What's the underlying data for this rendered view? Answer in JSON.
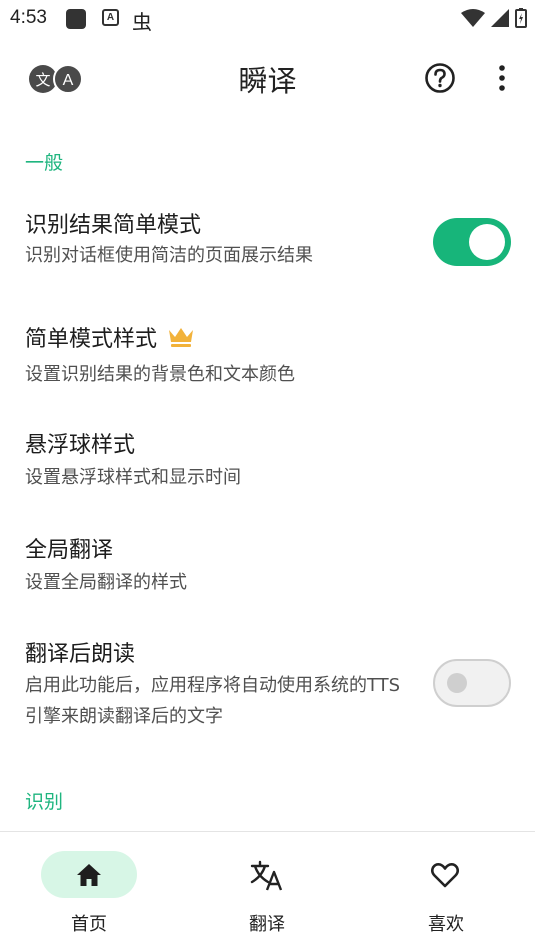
{
  "status_bar": {
    "time": "4:53"
  },
  "app_bar": {
    "title": "瞬译",
    "logo_text_left": "文",
    "logo_text_right": "A"
  },
  "sections": {
    "general": "一般",
    "recognition": "识别"
  },
  "settings": {
    "simple_mode": {
      "title": "识别结果简单模式",
      "subtitle": "识别对话框使用简洁的页面展示结果",
      "enabled": true
    },
    "simple_style": {
      "title": "简单模式样式",
      "subtitle": "设置识别结果的背景色和文本颜色",
      "premium_icon": "crown-icon"
    },
    "float_ball": {
      "title": "悬浮球样式",
      "subtitle": "设置悬浮球样式和显示时间"
    },
    "global_translate": {
      "title": "全局翻译",
      "subtitle": "设置全局翻译的样式"
    },
    "read_aloud": {
      "title": "翻译后朗读",
      "subtitle": "启用此功能后，应用程序将自动使用系统的TTS引擎来朗读翻译后的文字",
      "enabled": false
    }
  },
  "bottom_nav": [
    {
      "label": "首页",
      "icon": "home-icon",
      "selected": true
    },
    {
      "label": "翻译",
      "icon": "translate-icon",
      "selected": false
    },
    {
      "label": "喜欢",
      "icon": "heart-icon",
      "selected": false
    }
  ],
  "colors": {
    "accent": "#17b57a",
    "section_header": "#1fb57f",
    "nav_pill": "#d7f6e6",
    "crown": "#f2b23a"
  }
}
